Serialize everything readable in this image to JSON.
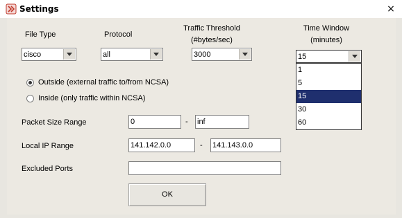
{
  "window": {
    "title": "Settings",
    "close_glyph": "×"
  },
  "headers": {
    "file_type": "File Type",
    "protocol": "Protocol",
    "traffic_threshold_line1": "Traffic Threshold",
    "traffic_threshold_line2": "(#bytes/sec)",
    "time_window_line1": "Time Window",
    "time_window_line2": "(minutes)"
  },
  "combos": {
    "file_type": "cisco",
    "protocol": "all",
    "traffic_threshold": "3000",
    "time_window": "15"
  },
  "time_window_options": [
    "1",
    "5",
    "15",
    "30",
    "60"
  ],
  "time_window_selected_index": 2,
  "radios": {
    "outside": "Outside (external traffic to/from NCSA)",
    "inside": "Inside (only traffic within NCSA)",
    "selected": "outside"
  },
  "fields": {
    "packet_size_label": "Packet Size Range",
    "packet_size_min": "0",
    "packet_size_max": "inf",
    "local_ip_label": "Local IP Range",
    "local_ip_start": "141.142.0.0",
    "local_ip_end": "141.143.0.0",
    "excluded_ports_label": "Excluded Ports",
    "excluded_ports_value": "",
    "dash": "-"
  },
  "ok_label": "OK",
  "colors": {
    "selection": "#1f2f6e",
    "app_icon": "#c0392b"
  }
}
